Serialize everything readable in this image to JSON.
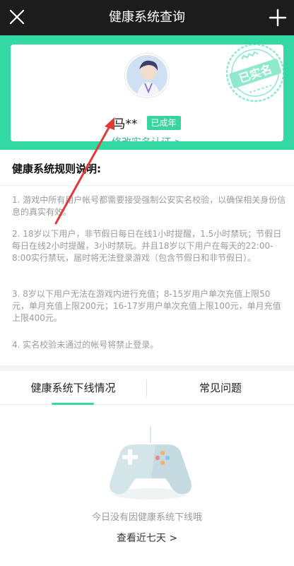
{
  "header": {
    "title": "健康系统查询"
  },
  "profile": {
    "name": "马**",
    "badge": "已成年",
    "edit_link": "修改实名认证 >",
    "stamp_text": "已实名"
  },
  "rules": {
    "title": "健康系统规则说明:",
    "items": [
      "1. 游戏中所有用户帐号都需要接受强制公安实名校验，以确保相关身份信息的真实有效。",
      "2. 18岁以下用户，非节假日每日在线1小时提醒，1.5小时禁玩；节假日每日在线2小时提醒，3小时禁玩。并且18岁以下用户在每天的22:00-8:00实行禁玩，届时将无法登录游戏（包含节假日和非节假日）。",
      "3. 8岁以下用户无法在游戏内进行充值；8-15岁用户单次充值上限50元，单月充值上限200元；16-17岁用户单次充值上限100元，单月充值上限400元。",
      "4. 实名校验未通过的帐号将禁止登录。"
    ]
  },
  "tabs": [
    {
      "label": "健康系统下线情况",
      "active": true
    },
    {
      "label": "常见问题",
      "active": false
    }
  ],
  "empty_state": {
    "message": "今日没有因健康系统下线哦",
    "link": "查看近七天 >"
  },
  "colors": {
    "accent": "#34d8a2",
    "titlebar": "#1c1c1c",
    "annotation_arrow": "#e23a3a"
  },
  "icons": {
    "close": "close-icon",
    "add": "plus-icon",
    "empty": "gamepad-icon"
  }
}
